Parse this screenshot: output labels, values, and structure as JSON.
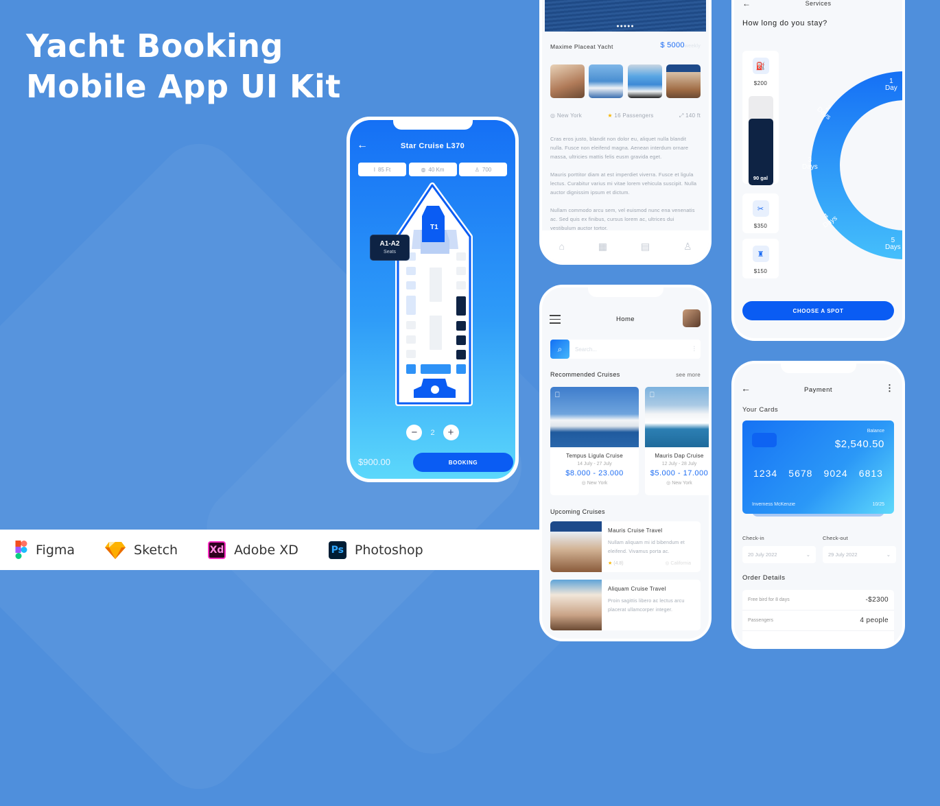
{
  "hero": {
    "line1": "Yacht Booking",
    "line2": "Mobile App UI Kit"
  },
  "tools": [
    {
      "name": "Figma",
      "icon": "figma-icon"
    },
    {
      "name": "Sketch",
      "icon": "sketch-icon"
    },
    {
      "name": "Adobe XD",
      "icon": "xd-icon",
      "glyph": "Xd"
    },
    {
      "name": "Photoshop",
      "icon": "photoshop-icon",
      "glyph": "Ps"
    }
  ],
  "seat_screen": {
    "back": "←",
    "title": "Star Cruise L370",
    "chips": [
      {
        "icon": "height-icon",
        "glyph": "I",
        "label": "85 Ft"
      },
      {
        "icon": "distance-icon",
        "glyph": "◍",
        "label": "40 Km"
      },
      {
        "icon": "person-icon",
        "glyph": "♙",
        "label": "700"
      }
    ],
    "table_label": "T1",
    "tooltip": {
      "title": "A1-A2",
      "subtitle": "Seats"
    },
    "quantity": {
      "minus": "−",
      "value": "2",
      "plus": "+"
    },
    "price": "$900.00",
    "book_button": "BOOKING",
    "colors": {
      "primary": "#0a5cf3",
      "selected_seat": "#0e2344",
      "available_seat": "#dce8fb"
    }
  },
  "detail_screen": {
    "carousel_dots": "●●●●●",
    "name": "Maxime Placeat Yacht",
    "price": "$ 5000",
    "price_period": "weekly",
    "location": "New York",
    "passengers": "16 Passengers",
    "size": "140 ft",
    "description": [
      "Cras eros justo, blandit non dolor eu, aliquet nulla blandit nulla. Fusce non eleifend magna. Aenean interdum ornare massa, ultricies mattis felis eusm gravida eget.",
      "Mauris porttitor diam at est imperdiet viverra. Fusce et ligula lectus. Curabitur varius mi vitae lorem vehicula suscipit. Nulla auctor dignissim ipsum et dictum.",
      "Nullam commodo arcu sem, vel euismod nunc ena venenatis ac. Sed quis ex finibus, cursus lorem ac, ultrices dui vestibulum auctor tortor."
    ],
    "tabbar": [
      "home",
      "grid",
      "document",
      "profile"
    ]
  },
  "home_screen": {
    "title": "Home",
    "search_placeholder": "Search...",
    "recommended_title": "Recommended Cruises",
    "see_more": "see more",
    "recommended": [
      {
        "name": "Tempus Ligula Cruise",
        "dates": "14 July - 27 July",
        "price": "$8.000 - 23.000",
        "location": "New York"
      },
      {
        "name": "Mauris Dap Cruise",
        "dates": "12 July - 28 July",
        "price": "$5.000 - 17.000",
        "location": "New York"
      }
    ],
    "upcoming_title": "Upcoming Cruises",
    "upcoming": [
      {
        "name": "Mauris Cruise Travel",
        "desc": "Nullam aliquam mi id bibendum et eleifend. Vivamus porta ac.",
        "rating": "(4.8)",
        "location": "California"
      },
      {
        "name": "Aliquam Cruise Travel",
        "desc": "Proin sagittis libero ac lectus arcu placerat ullamcorper integer."
      }
    ]
  },
  "services_screen": {
    "title": "Services",
    "question": "How long do you stay?",
    "services": [
      {
        "icon": "fuel-icon",
        "glyph": "⛽",
        "price": "$200",
        "tank_label": "90 gal",
        "tank_fill": 0.75
      },
      {
        "icon": "tools-icon",
        "glyph": "✂",
        "price": "$350"
      },
      {
        "icon": "cleaning-icon",
        "glyph": "🧹",
        "price": "$150"
      }
    ],
    "durations": [
      {
        "num": "1",
        "unit": "Day"
      },
      {
        "num": "2",
        "unit": "Days"
      },
      {
        "num": "3",
        "unit": "Days"
      },
      {
        "num": "4",
        "unit": "Days"
      },
      {
        "num": "5",
        "unit": "Days"
      }
    ],
    "button": "CHOOSE A SPOT"
  },
  "payment_screen": {
    "title": "Payment",
    "cards_title": "Your Cards",
    "card": {
      "balance_label": "Balance",
      "balance": "$2,540.50",
      "number": [
        "1234",
        "5678",
        "9024",
        "6813"
      ],
      "holder": "Inverness McKenzie",
      "expiry": "10/25"
    },
    "checkin_label": "Check-in",
    "checkin_value": "20 July 2022",
    "checkout_label": "Check-out",
    "checkout_value": "29 July 2022",
    "order_title": "Order Details",
    "order": [
      {
        "label": "Free bird for 8 days",
        "value": "-$2300"
      },
      {
        "label": "Passengers",
        "value": "4 people"
      }
    ]
  }
}
